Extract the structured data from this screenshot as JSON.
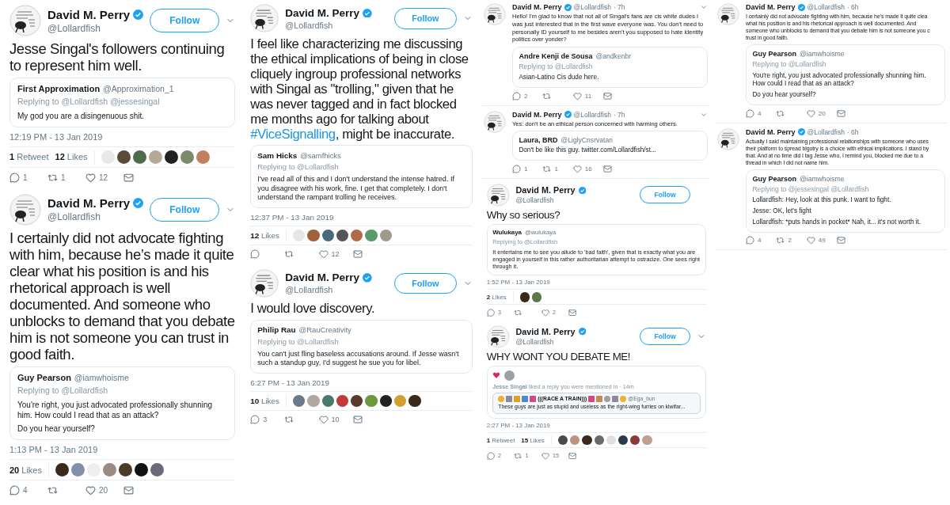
{
  "columns": [
    {
      "items": [
        {
          "kind": "tweet",
          "name": "David M. Perry",
          "verified": true,
          "handle": "@Lollardfish",
          "follow": "Follow",
          "menu": true,
          "body": [
            {
              "text": "Jesse Singal's followers continuing to represent him well.",
              "link": false
            }
          ],
          "quote": {
            "kind": "reply",
            "name": "First Approximation",
            "handle": "@Approximation_1",
            "replying": "Replying to @Lollardfish @jessesingal",
            "paragraphs": [
              "My god you are a disingenuous shit."
            ]
          },
          "time": "12:19 PM - 13 Jan 2019",
          "stats": [
            "**1** Retweet",
            "**12** Likes"
          ],
          "likers": [
            {
              "color": "#e8e8e8"
            },
            {
              "color": "#5a4a3a"
            },
            {
              "color": "#4e6b4a"
            },
            {
              "color": "#b8a89a"
            },
            {
              "color": "#222222"
            },
            {
              "color": "#7a8a6a"
            },
            {
              "color": "#c08060"
            }
          ],
          "actions": {
            "reply": "1",
            "retweet": "1",
            "like": "12"
          }
        },
        {
          "kind": "tweet",
          "name": "David M. Perry",
          "verified": true,
          "handle": "@Lollardfish",
          "follow": "Follow",
          "menu": true,
          "body": [
            {
              "text": "I certainly did not advocate fighting with him, because he’s made it quite clear what his position is and his rhetorical approach is well documented. And someone who unblocks to demand that you debate him is not someone you can trust in good faith.",
              "link": false
            }
          ],
          "quote": {
            "kind": "reply",
            "name": "Guy Pearson",
            "handle": "@iamwhoisme",
            "replying": "Replying to @Lollardfish",
            "paragraphs": [
              "You're right, you just advocated professionally shunning him. How could I read that as an attack?",
              "Do you hear yourself?"
            ]
          },
          "time": "1:13 PM - 13 Jan 2019",
          "stats": [
            "**20** Likes"
          ],
          "likers": [
            {
              "color": "#3a2a20"
            },
            {
              "color": "#8090a8"
            },
            {
              "color": "#eeeeee"
            },
            {
              "color": "#9a8a80"
            },
            {
              "color": "#4a3a2a"
            },
            {
              "color": "#111111"
            },
            {
              "color": "#6a6a7a"
            }
          ],
          "actions": {
            "reply": "4",
            "like": "20"
          }
        }
      ]
    },
    {
      "items": [
        {
          "kind": "tweet",
          "name": "David M. Perry",
          "verified": true,
          "handle": "@Lollardfish",
          "follow": "Follow",
          "menu": true,
          "body": [
            {
              "text": "I feel like characterizing me discussing the ethical implications of being in close cliquely ingroup professional networks with Singal as \"trolling,\" given that he was never tagged and in fact blocked me months ago for talking about ",
              "link": false
            },
            {
              "text": "#ViceSignalling",
              "link": true
            },
            {
              "text": ", might be inaccurate.",
              "link": false
            }
          ],
          "quote": {
            "kind": "reply",
            "name": "Sam Hicks",
            "handle": "@samfhicks",
            "replying": "Replying to @Lollardfish",
            "paragraphs": [
              "I've read all of this and I don't understand the intense hatred. If you disagree with his work, fine. I get that completely. I don't understand the rampant trolling he receives."
            ]
          },
          "time": "12:37 PM - 13 Jan 2019",
          "stats": [
            "**12** Likes"
          ],
          "likers": [
            {
              "color": "#e6e6e6"
            },
            {
              "color": "#a0603a"
            },
            {
              "color": "#4a6a7a"
            },
            {
              "color": "#555555"
            },
            {
              "color": "#b06a4a"
            },
            {
              "color": "#5a9a6a"
            },
            {
              "color": "#a09a8a"
            }
          ],
          "actions": {
            "like": "12"
          }
        },
        {
          "kind": "tweet",
          "name": "David M. Perry",
          "verified": true,
          "handle": "@Lollardfish",
          "follow": "Follow",
          "menu": true,
          "body": [
            {
              "text": "I would love discovery.",
              "link": false
            }
          ],
          "quote": {
            "kind": "reply",
            "name": "Philip Rau",
            "handle": "@RauCreativity",
            "replying": "Replying to @Lollardfish",
            "paragraphs": [
              "You can't just fling baseless accusations around. If Jesse wasn't such a standup guy, I'd suggest he sue you for libel."
            ]
          },
          "time": "6:27 PM - 13 Jan 2019",
          "stats": [
            "**10** Likes"
          ],
          "likers": [
            {
              "color": "#6a7a8a"
            },
            {
              "color": "#b0a8a0"
            },
            {
              "color": "#4a7a6a"
            },
            {
              "color": "#c03a3a"
            },
            {
              "color": "#5a3a2a"
            },
            {
              "color": "#6a9a3a"
            },
            {
              "color": "#222222"
            },
            {
              "color": "#d0a030"
            },
            {
              "color": "#3a2a1a"
            }
          ],
          "actions": {
            "reply": "3",
            "like": "10"
          }
        }
      ]
    },
    {
      "items": [
        {
          "kind": "reply",
          "name": "David M. Perry",
          "verified": true,
          "handle": "@Lollardfish",
          "time": "· 7h",
          "menu": true,
          "text": "Hello! I'm glad to know that not all of Singal's fans are cis white dudes I was just interested that in the first wave everyone was. You don't need to personally ID yourself to me besides aren't you supposed to hate identity politics over yonder?",
          "quote": {
            "kind": "reply",
            "name": "Andre Kenji de Sousa",
            "handle": "@andkenbr",
            "replying": "Replying to @Lollardfish",
            "paragraphs": [
              "Asian-Latino Cis dude here."
            ]
          },
          "actions": {
            "reply": "2",
            "like": "11"
          }
        },
        {
          "kind": "reply",
          "name": "David M. Perry",
          "verified": true,
          "handle": "@Lollardfish",
          "time": "· 7h",
          "menu": true,
          "text": "Yes: don't be an ethical person concerned with harming others.",
          "quote": {
            "kind": "reply",
            "name": "Laura, BRD",
            "handle": "@LiglyCnsrvatari",
            "paragraphs": [
              "Don't be like this guy. twitter.com/Lollardfish/st..."
            ]
          },
          "actions": {
            "reply": "1",
            "retweet": "1",
            "like": "16"
          }
        },
        {
          "kind": "tweet",
          "name": "David M. Perry",
          "verified": true,
          "handle": "@Lollardfish",
          "follow": "Follow",
          "menu": false,
          "body": [
            {
              "text": "Why so serious?",
              "link": false
            }
          ],
          "quote": {
            "kind": "reply",
            "name": "Wulukaya",
            "handle": "@wulukaya",
            "replying": "Replying to @Lollardfish",
            "paragraphs": [
              "It entertains me to see you allude to 'bad faith', given that is exactly what you are engaged in yourself in this rather authoritarian attempt to ostracize. One sees right through it."
            ]
          },
          "time": "1:52 PM - 13 Jan 2019",
          "stats": [
            "**2** Likes"
          ],
          "likers": [
            {
              "color": "#3a2a1a"
            },
            {
              "color": "#5a7a4a"
            }
          ],
          "actions": {
            "reply": "3",
            "like": "2"
          }
        },
        {
          "kind": "tweet",
          "name": "David M. Perry",
          "verified": true,
          "handle": "@Lollardfish",
          "follow": "Follow",
          "menu": true,
          "body": [
            {
              "text": "WHY WONT YOU DEBATE ME!",
              "link": false
            }
          ],
          "quote": {
            "kind": "notification",
            "line": "**Jesse Singal** liked a reply you were mentioned in · 14m",
            "inner": {
              "name": "(((RACE A TRAIN)))",
              "handle": "@Ega_bun",
              "text": "These guys are just as stupid and useless as the right-wing furries on kiwifar..."
            }
          },
          "time": "2:27 PM - 13 Jan 2019",
          "stats": [
            "**1** Retweet",
            "**15** Likes"
          ],
          "likers": [
            {
              "color": "#4a4a4a"
            },
            {
              "color": "#c09080"
            },
            {
              "color": "#3a2a1a"
            },
            {
              "color": "#6a6a6a"
            },
            {
              "color": "#e0e0e0"
            },
            {
              "color": "#2a3a4a"
            },
            {
              "color": "#8a3a3a"
            },
            {
              "color": "#c0a090"
            }
          ],
          "actions": {
            "reply": "2",
            "retweet": "1",
            "like": "15"
          }
        }
      ]
    },
    {
      "items": [
        {
          "kind": "reply",
          "name": "David M. Perry",
          "verified": true,
          "handle": "@Lollardfish",
          "time": "· 6h",
          "menu": false,
          "lines": [
            "I certainly did not advocate fighting with him, because he's made it quite clea",
            "what his position is and his rhetorical approach is well documented. And",
            "someone who unblocks to demand that you debate him is not someone you c",
            "trust in good faith."
          ],
          "quote": {
            "kind": "reply",
            "name": "Guy Pearson",
            "handle": "@iamwhoisme",
            "replying": "Replying to @Lollardfish",
            "paragraphs": [
              "You're right, you just advocated professionally shunning him. How could I read that as an attack?",
              "Do you hear yourself?"
            ]
          },
          "actions": {
            "reply": "4",
            "like": "20"
          }
        },
        {
          "kind": "reply",
          "name": "David M. Perry",
          "verified": true,
          "handle": "@Lollardfish",
          "time": "· 6h",
          "menu": false,
          "lines": [
            "Actually I said maintaining professional relationships with someone who uses",
            "their platform to spread bigotry is a choice with ethical implications. I stand by",
            "that. And at no time did I tag Jesse who, I remind you, blocked me due to a",
            "thread in which I did not name him."
          ],
          "quote": {
            "kind": "reply",
            "name": "Guy Pearson",
            "handle": "@iamwhoisme",
            "replying": "Replying to @jessesingal @Lollardfish",
            "paragraphs": [
              "Lollardfish: Hey, look at this punk. I want to fight.",
              "Jesse: OK, let's fight",
              "Lollardfish: *puts hands in pocket* Nah, it... it's not worth it."
            ]
          },
          "actions": {
            "reply": "4",
            "retweet": "2",
            "like": "49"
          }
        }
      ]
    }
  ]
}
